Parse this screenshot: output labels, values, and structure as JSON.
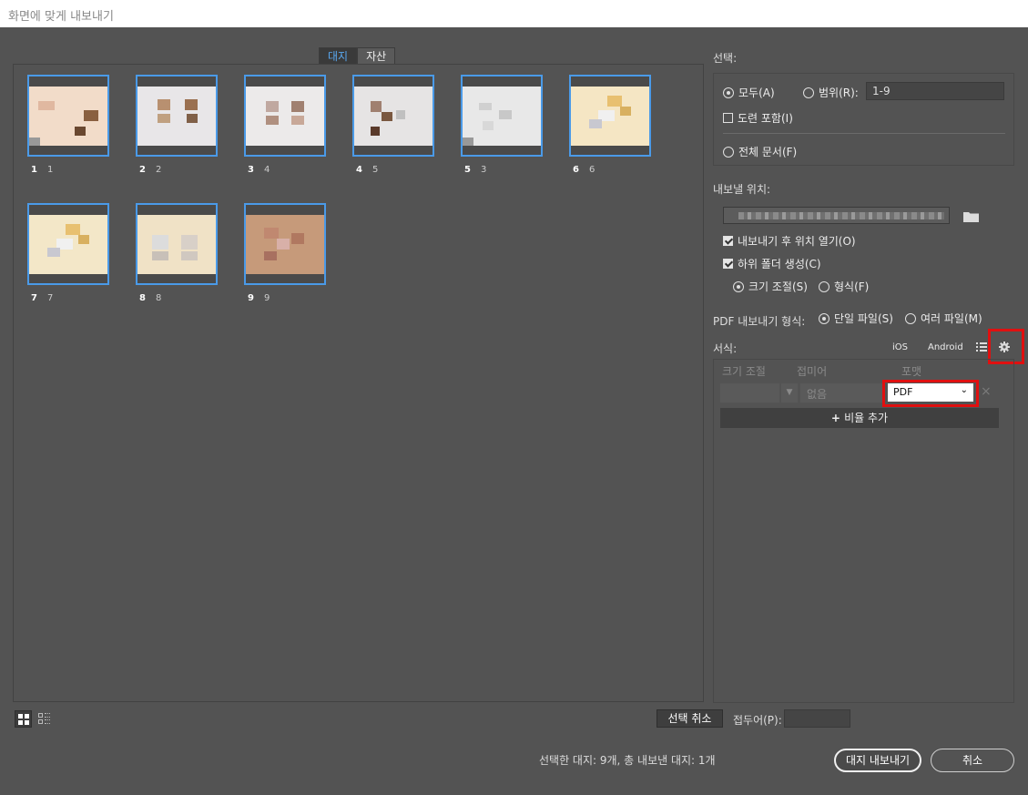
{
  "window": {
    "title": "화면에 맞게 내보내기"
  },
  "tabs": [
    {
      "label": "대지"
    },
    {
      "label": "자산"
    }
  ],
  "thumbnails": [
    {
      "num": "1",
      "id": "1",
      "tone": "#f2dcc9"
    },
    {
      "num": "2",
      "id": "2",
      "tone": "#e8e6e8"
    },
    {
      "num": "3",
      "id": "4",
      "tone": "#eceaea"
    },
    {
      "num": "4",
      "id": "5",
      "tone": "#e6e4e4"
    },
    {
      "num": "5",
      "id": "3",
      "tone": "#e8e8e8"
    },
    {
      "num": "6",
      "id": "6",
      "tone": "#f5e6c4"
    },
    {
      "num": "7",
      "id": "7",
      "tone": "#f3e7c8"
    },
    {
      "num": "8",
      "id": "8",
      "tone": "#f0e2c6"
    },
    {
      "num": "9",
      "id": "9",
      "tone": "#c69a7a"
    }
  ],
  "select": {
    "label": "선택:",
    "all": "모두(A)",
    "range": "범위(R):",
    "range_value": "1-9",
    "include_bleed": "도련 포함(I)",
    "full_document": "전체 문서(F)"
  },
  "export_to": {
    "label": "내보낼 위치:",
    "open_after": "내보내기 후 위치 열기(O)",
    "create_subfolders": "하위 폴더 생성(C)",
    "by_scale": "크기 조절(S)",
    "by_format": "형식(F)"
  },
  "pdf_export": {
    "label": "PDF 내보내기 형식:",
    "single": "단일 파일(S)",
    "multiple": "여러 파일(M)"
  },
  "formats": {
    "label": "서식:",
    "ios": "iOS",
    "android": "Android",
    "columns": {
      "scale": "크기 조절",
      "suffix": "접미어",
      "format": "포맷"
    },
    "suffix_placeholder": "없음",
    "format_value": "PDF",
    "add_scale": "비율 추가"
  },
  "bottom": {
    "deselect": "선택 취소",
    "prefix_label": "접두어(P):",
    "summary": "선택한 대지: 9개, 총 내보낸 대지: 1개",
    "export_button": "대지 내보내기",
    "cancel_button": "취소"
  },
  "colors": {
    "accent": "#4a9ae8",
    "highlight": "#e01010",
    "background": "#535353"
  }
}
